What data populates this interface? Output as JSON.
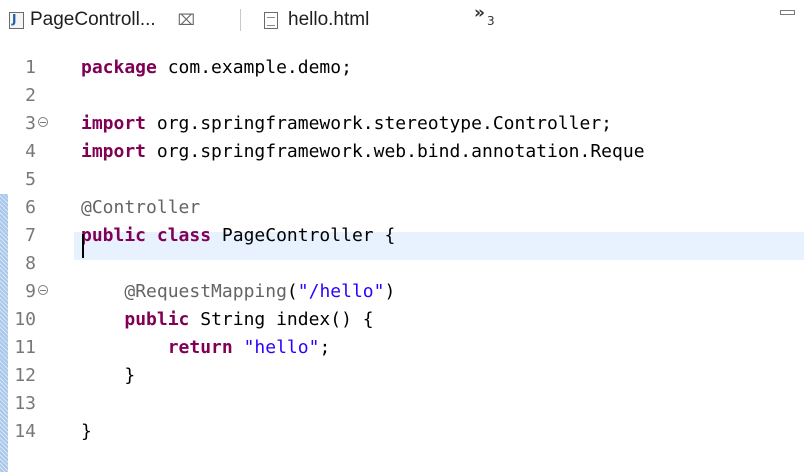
{
  "tabs": [
    {
      "label": "PageControll...",
      "close_symbol": "⌧",
      "icon": "java-file-icon",
      "active": true
    },
    {
      "label": "hello.html",
      "icon": "html-file-icon",
      "active": false
    }
  ],
  "tab_overflow": {
    "symbol": "»",
    "count": "3"
  },
  "editor": {
    "lines": [
      {
        "number": "1",
        "tokens": [
          {
            "type": "kw",
            "text": "package"
          },
          {
            "type": "plain",
            "text": " com.example.demo;"
          }
        ]
      },
      {
        "number": "2",
        "tokens": []
      },
      {
        "number": "3",
        "fold": true,
        "tokens": [
          {
            "type": "kw",
            "text": "import"
          },
          {
            "type": "plain",
            "text": " org.springframework.stereotype.Controller;"
          }
        ]
      },
      {
        "number": "4",
        "tokens": [
          {
            "type": "kw",
            "text": "import"
          },
          {
            "type": "plain",
            "text": " org.springframework.web.bind.annotation.Reque"
          }
        ]
      },
      {
        "number": "5",
        "tokens": []
      },
      {
        "number": "6",
        "tokens": [
          {
            "type": "ann",
            "text": "@Controller"
          }
        ]
      },
      {
        "number": "7",
        "tokens": [
          {
            "type": "kw",
            "text": "public"
          },
          {
            "type": "plain",
            "text": " "
          },
          {
            "type": "kw",
            "text": "class"
          },
          {
            "type": "plain",
            "text": " PageController {"
          }
        ]
      },
      {
        "number": "8",
        "tokens": []
      },
      {
        "number": "9",
        "fold": true,
        "tokens": [
          {
            "type": "plain",
            "text": "    "
          },
          {
            "type": "ann",
            "text": "@RequestMapping"
          },
          {
            "type": "plain",
            "text": "("
          },
          {
            "type": "str",
            "text": "\"/hello\""
          },
          {
            "type": "plain",
            "text": ")"
          }
        ]
      },
      {
        "number": "10",
        "tokens": [
          {
            "type": "plain",
            "text": "    "
          },
          {
            "type": "kw",
            "text": "public"
          },
          {
            "type": "plain",
            "text": " String index() {"
          }
        ]
      },
      {
        "number": "11",
        "tokens": [
          {
            "type": "plain",
            "text": "        "
          },
          {
            "type": "kw",
            "text": "return"
          },
          {
            "type": "plain",
            "text": " "
          },
          {
            "type": "str",
            "text": "\"hello\""
          },
          {
            "type": "plain",
            "text": ";"
          }
        ]
      },
      {
        "number": "12",
        "tokens": [
          {
            "type": "plain",
            "text": "    }"
          }
        ]
      },
      {
        "number": "13",
        "tokens": []
      },
      {
        "number": "14",
        "tokens": [
          {
            "type": "plain",
            "text": "}"
          }
        ]
      }
    ],
    "current_line": "8"
  },
  "colors": {
    "keyword": "#7f0055",
    "annotation": "#646464",
    "string": "#2a00ff",
    "line_number": "#787878",
    "current_line_highlight": "#e8f2fe",
    "change_ruler": "#a9c7ea"
  }
}
